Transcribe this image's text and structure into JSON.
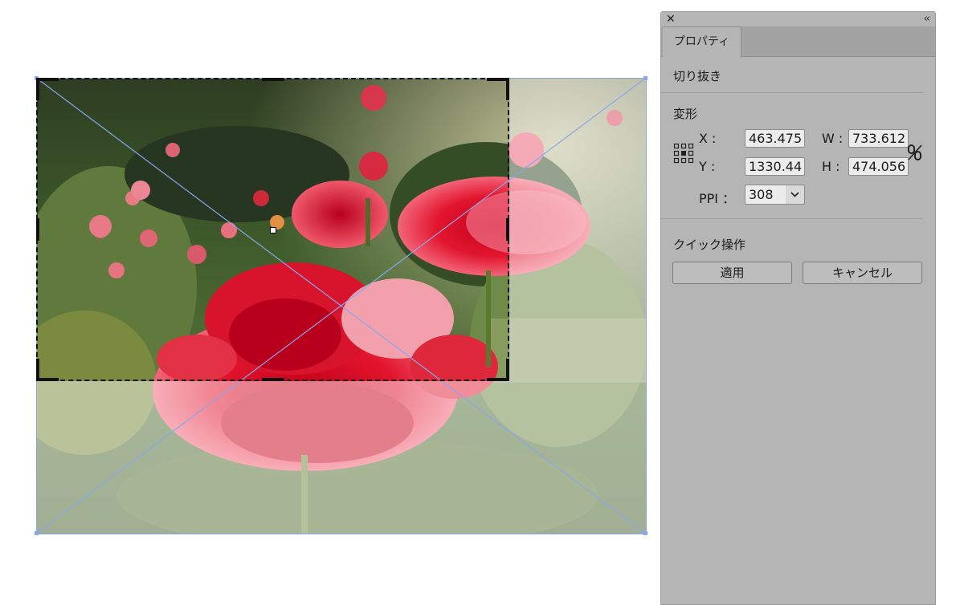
{
  "panel": {
    "tab_label": "プロパティ",
    "close_icon": "close-icon",
    "collapse_icon": "collapse-double-chevron-icon"
  },
  "crop_section": {
    "title": "切り抜き"
  },
  "transform": {
    "title": "変形",
    "x_label": "X :",
    "x_value": "463.475",
    "y_label": "Y :",
    "y_value": "1330.44",
    "w_label": "W :",
    "w_value": "733.612",
    "h_label": "H :",
    "h_value": "474.056",
    "ppi_label": "PPI ：",
    "ppi_value": "308",
    "reference_point_icon": "reference-point-grid-icon",
    "constrain_icon": "unlink-proportions-icon"
  },
  "quick_actions": {
    "title": "クイック操作",
    "apply_label": "適用",
    "cancel_label": "キャンセル"
  },
  "colors": {
    "panel_bg": "#b5b5b5",
    "selection_blue": "#8aa6ee",
    "crop_marquee": "#111111"
  }
}
